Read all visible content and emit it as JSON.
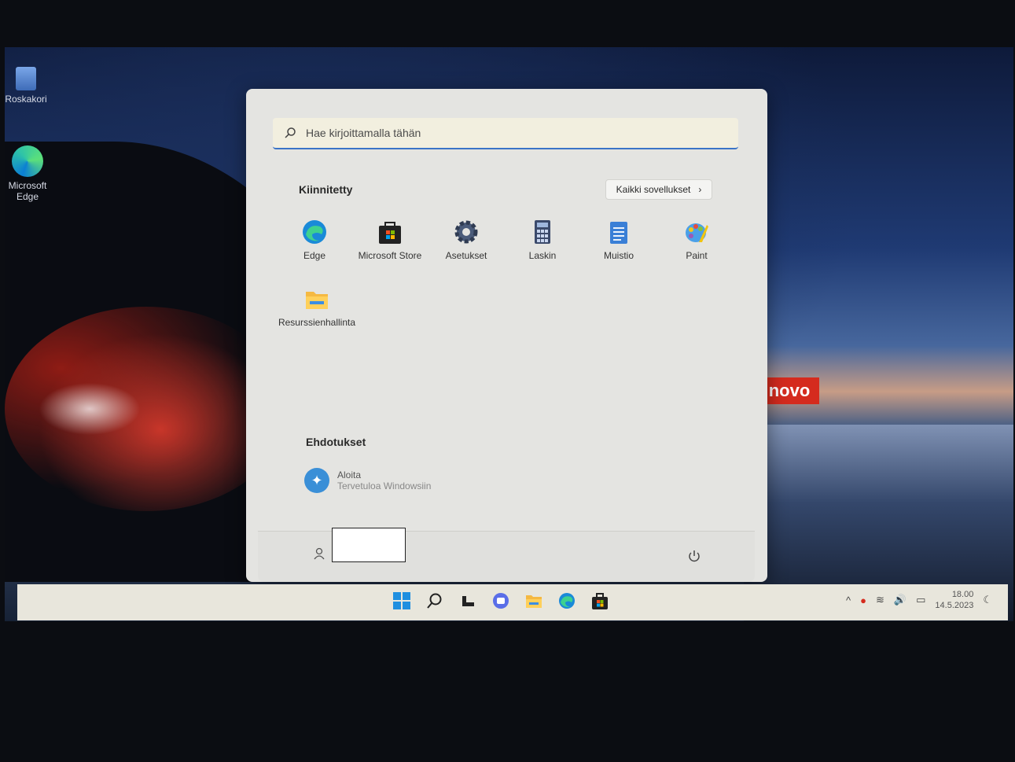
{
  "desktop": {
    "icons": [
      {
        "label": "Roskakori",
        "icon": "recycle-bin-icon"
      },
      {
        "label": "Microsoft Edge",
        "icon": "edge-icon"
      }
    ],
    "brand_badge": "novo"
  },
  "start_menu": {
    "search_placeholder": "Hae kirjoittamalla tähän",
    "pinned_title": "Kiinnitetty",
    "all_apps_label": "Kaikki sovellukset",
    "pinned_apps": [
      {
        "label": "Edge",
        "icon": "edge-icon"
      },
      {
        "label": "Microsoft Store",
        "icon": "store-icon"
      },
      {
        "label": "Asetukset",
        "icon": "settings-gear-icon"
      },
      {
        "label": "Laskin",
        "icon": "calculator-icon"
      },
      {
        "label": "Muistio",
        "icon": "notepad-icon"
      },
      {
        "label": "Paint",
        "icon": "paint-icon"
      },
      {
        "label": "Resurssienhallinta",
        "icon": "file-explorer-icon"
      }
    ],
    "suggestions_title": "Ehdotukset",
    "suggestions": [
      {
        "title": "Aloita",
        "subtitle": "Tervetuloa Windowsiin",
        "icon": "get-started-icon"
      }
    ]
  },
  "taskbar": {
    "apps": [
      "start-icon",
      "search-icon",
      "task-view-icon",
      "chat-icon",
      "file-explorer-icon",
      "edge-icon",
      "store-icon"
    ],
    "clock": {
      "time": "18.00",
      "date": "14.5.2023"
    }
  }
}
